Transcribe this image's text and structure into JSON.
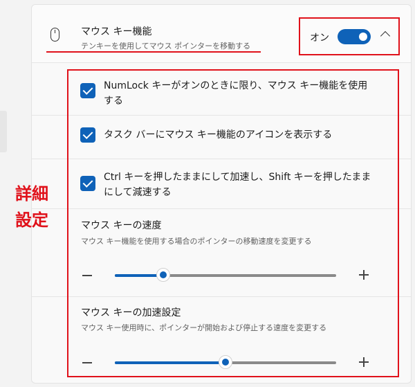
{
  "header": {
    "title": "マウス キー機能",
    "subtitle": "テンキーを使用してマウス ポインターを移動する",
    "toggle_label": "オン",
    "toggle_on": true
  },
  "options": [
    {
      "label": "NumLock キーがオンのときに限り、マウス キー機能を使用する",
      "checked": true
    },
    {
      "label": "タスク バーにマウス キー機能のアイコンを表示する",
      "checked": true
    },
    {
      "label": "Ctrl キーを押したままにして加速し、Shift キーを押したままにして減速する",
      "checked": true
    }
  ],
  "speed": {
    "title": "マウス キーの速度",
    "description": "マウス キー機能を使用する場合のポインターの移動速度を変更する",
    "value": 0.22
  },
  "acceleration": {
    "title": "マウス キーの加速設定",
    "description": "マウス キー使用時に、ポインターが開始および停止する速度を変更する",
    "value": 0.5
  },
  "annotation": {
    "line1": "詳細",
    "line2": "設定"
  },
  "colors": {
    "accent": "#0f62b8",
    "highlight": "#e0111a"
  }
}
